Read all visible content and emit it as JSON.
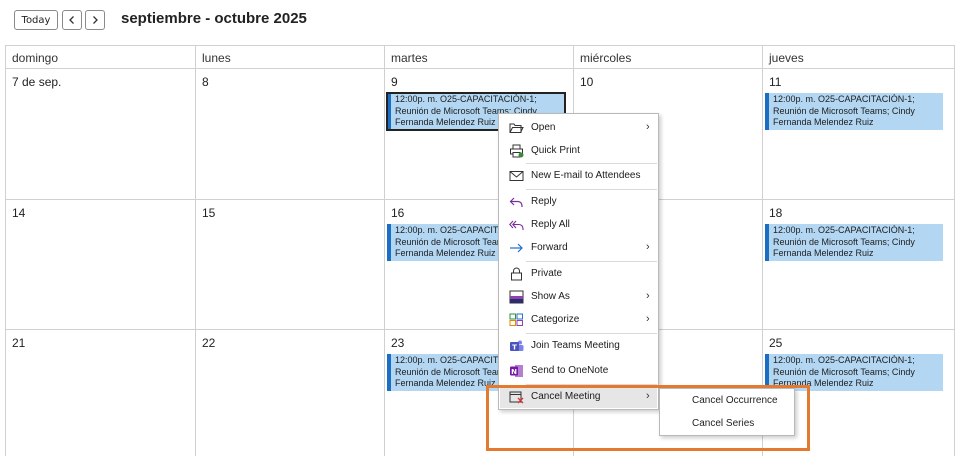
{
  "toolbar": {
    "today_label": "Today",
    "range_title": "septiembre - octubre 2025"
  },
  "calendar": {
    "day_headers": [
      "domingo",
      "lunes",
      "martes",
      "miércoles",
      "jueves"
    ],
    "weeks": [
      {
        "dates": [
          "7 de sep.",
          "8",
          "9",
          "10",
          "11"
        ]
      },
      {
        "dates": [
          "14",
          "15",
          "16",
          "",
          "18"
        ]
      },
      {
        "dates": [
          "21",
          "22",
          "23",
          "",
          "25"
        ]
      }
    ],
    "event": {
      "line1": "12:00p. m. O25-CAPACITACIÓN-1;",
      "line2": "Reunión de Microsoft Teams; Cindy",
      "line3": "Fernanda Melendez Ruiz"
    },
    "event_color": "#b3d7f3",
    "event_accent": "#1a6fc4"
  },
  "context_menu": {
    "items": [
      {
        "label": "Open",
        "icon": "open-folder-icon",
        "submenu": true
      },
      {
        "label": "Quick Print",
        "icon": "printer-icon",
        "submenu": false
      },
      {
        "label": "New E-mail to Attendees",
        "icon": "envelope-icon",
        "submenu": false
      },
      {
        "label": "Reply",
        "icon": "reply-icon",
        "submenu": false
      },
      {
        "label": "Reply All",
        "icon": "reply-all-icon",
        "submenu": false
      },
      {
        "label": "Forward",
        "icon": "forward-icon",
        "submenu": true
      },
      {
        "label": "Private",
        "icon": "lock-icon",
        "submenu": false
      },
      {
        "label": "Show As",
        "icon": "show-as-icon",
        "submenu": true
      },
      {
        "label": "Categorize",
        "icon": "categorize-icon",
        "submenu": true
      },
      {
        "label": "Join Teams Meeting",
        "icon": "teams-icon",
        "submenu": false
      },
      {
        "label": "Send to OneNote",
        "icon": "onenote-icon",
        "submenu": false
      },
      {
        "label": "Cancel Meeting",
        "icon": "cancel-meeting-icon",
        "submenu": true
      }
    ]
  },
  "submenu": {
    "items": [
      "Cancel Occurrence",
      "Cancel Series"
    ]
  },
  "colors": {
    "highlight": "#e47a2f",
    "menu_hover": "#e6e6e6"
  }
}
